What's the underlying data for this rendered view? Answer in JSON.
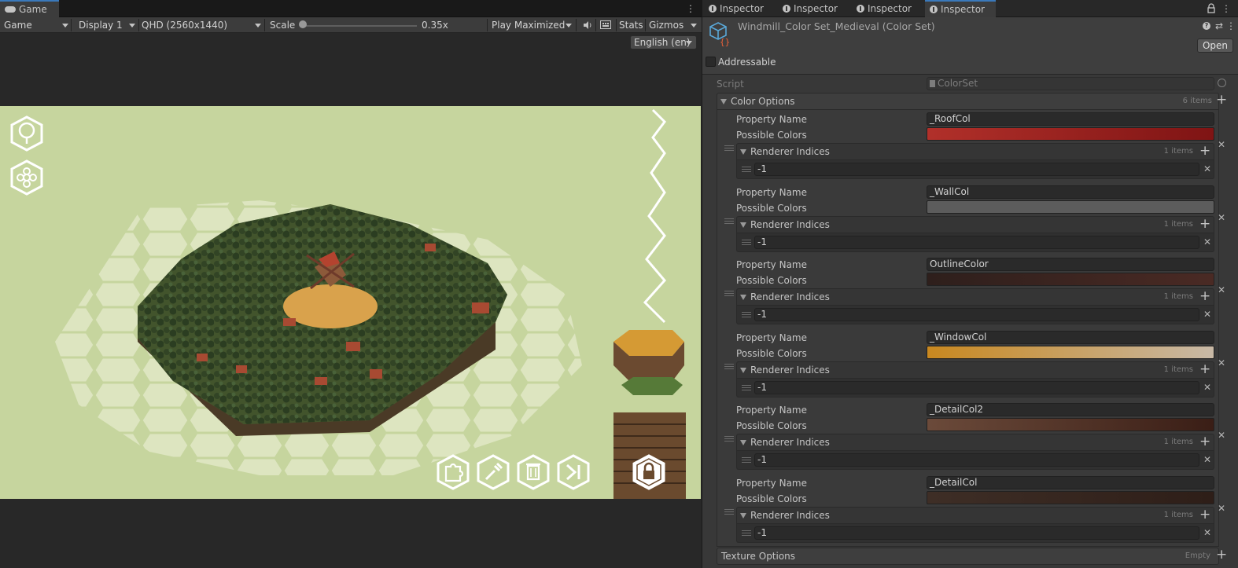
{
  "game": {
    "tab_label": "Game",
    "toolbar": {
      "mode": "Game",
      "display": "Display 1",
      "resolution": "QHD (2560x1440)",
      "scale_label": "Scale",
      "scale_value": "0.35x",
      "play_mode": "Play Maximized",
      "stats": "Stats",
      "gizmos": "Gizmos"
    },
    "language": "English (en)",
    "hud_icons": [
      "tree-icon",
      "flower-icon",
      "puzzle-icon",
      "eyedropper-icon",
      "trash-icon",
      "skip-end-icon",
      "lock-icon"
    ]
  },
  "inspector": {
    "tabs": [
      "Inspector",
      "Inspector",
      "Inspector",
      "Inspector"
    ],
    "active_tab": 3,
    "title": "Windmill_Color Set_Medieval (Color Set)",
    "open_label": "Open",
    "addressable_label": "Addressable",
    "script_label": "Script",
    "script_value": "ColorSet",
    "color_options_label": "Color Options",
    "color_options_count": "6 items",
    "texture_options_label": "Texture Options",
    "texture_options_count": "Empty",
    "property_name_label": "Property Name",
    "possible_colors_label": "Possible Colors",
    "renderer_indices_label": "Renderer Indices",
    "items": [
      {
        "property": "_RoofCol",
        "gradient": [
          "#b1302a",
          "#7f1414"
        ],
        "indices_count": "1 items",
        "index_value": "-1"
      },
      {
        "property": "_WallCol",
        "gradient": [
          "#5c5c5c",
          "#5c5c5c"
        ],
        "indices_count": "1 items",
        "index_value": "-1"
      },
      {
        "property": "OutlineColor",
        "gradient": [
          "#2e1f1c",
          "#4a2a24"
        ],
        "indices_count": "1 items",
        "index_value": "-1"
      },
      {
        "property": "_WindowCol",
        "gradient": [
          "#c9881f",
          "#c8b9a6"
        ],
        "indices_count": "1 items",
        "index_value": "-1"
      },
      {
        "property": "_DetailCol2",
        "gradient": [
          "#6b4a3a",
          "#3a1e16"
        ],
        "indices_count": "1 items",
        "index_value": "-1"
      },
      {
        "property": "_DetailCol",
        "gradient": [
          "#3e2e26",
          "#2e1e18"
        ],
        "indices_count": "1 items",
        "index_value": "-1"
      }
    ]
  }
}
